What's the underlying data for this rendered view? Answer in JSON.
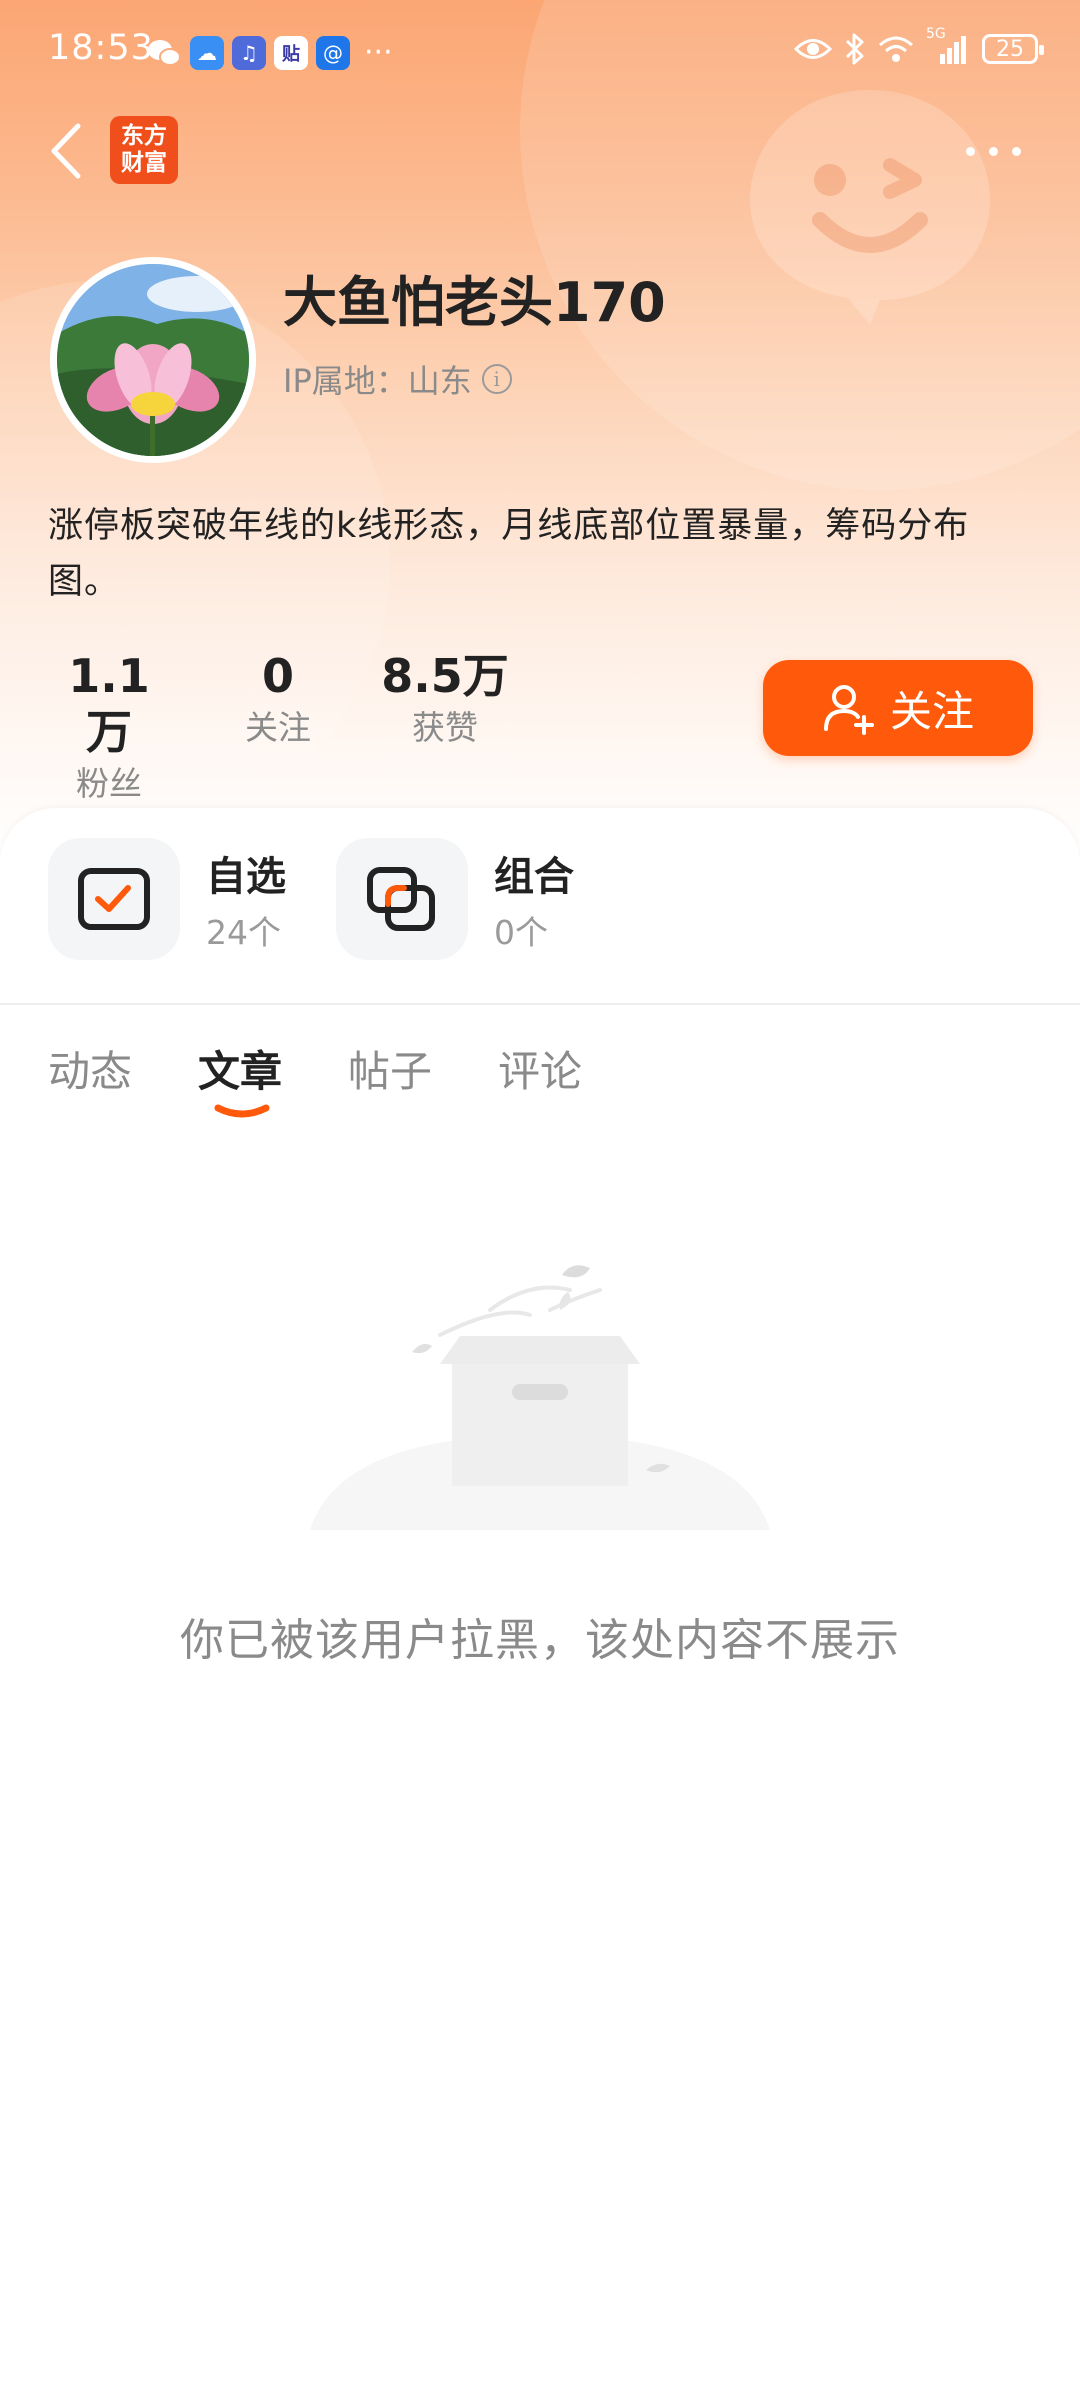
{
  "status_bar": {
    "time": "18:53",
    "network": "5G",
    "battery": "25",
    "overflow": "···"
  },
  "nav": {
    "logo_line1": "东方",
    "logo_line2": "财富"
  },
  "profile": {
    "username": "大鱼怕老头170",
    "ip_location": "IP属地：山东",
    "bio": "涨停板突破年线的k线形态，月线底部位置暴量，筹码分布图。"
  },
  "stats": [
    {
      "value": "1.1万",
      "label": "粉丝"
    },
    {
      "value": "0",
      "label": "关注"
    },
    {
      "value": "8.5万",
      "label": "获赞"
    }
  ],
  "follow_button": {
    "label": "关注"
  },
  "quick_links": [
    {
      "title": "自选",
      "count": "24个"
    },
    {
      "title": "组合",
      "count": "0个"
    }
  ],
  "tabs": [
    {
      "label": "动态",
      "active": false
    },
    {
      "label": "文章",
      "active": true
    },
    {
      "label": "帖子",
      "active": false
    },
    {
      "label": "评论",
      "active": false
    }
  ],
  "empty_state": {
    "message": "你已被该用户拉黑，该处内容不展示"
  },
  "colors": {
    "accent": "#ff5a0c",
    "header_gradient_top": "#fba673",
    "text_primary": "#222222",
    "text_secondary": "#8a8a8a"
  }
}
